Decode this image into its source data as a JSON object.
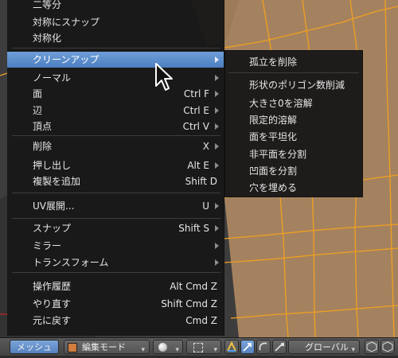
{
  "menu": {
    "items": [
      {
        "label": "二等分",
        "shortcut": "",
        "submenu": false
      },
      {
        "label": "対称にスナップ",
        "shortcut": "",
        "submenu": false
      },
      {
        "label": "対称化",
        "shortcut": "",
        "submenu": false
      },
      {
        "label": "クリーンアップ",
        "shortcut": "",
        "submenu": true,
        "highlighted": true
      },
      {
        "label": "ノーマル",
        "shortcut": "",
        "submenu": true
      },
      {
        "label": "面",
        "shortcut": "Ctrl F",
        "submenu": true
      },
      {
        "label": "辺",
        "shortcut": "Ctrl E",
        "submenu": true
      },
      {
        "label": "頂点",
        "shortcut": "Ctrl V",
        "submenu": true
      },
      {
        "label": "削除",
        "shortcut": "X",
        "submenu": true
      },
      {
        "label": "押し出し",
        "shortcut": "Alt E",
        "submenu": true
      },
      {
        "label": "複製を追加",
        "shortcut": "Shift D",
        "submenu": false
      },
      {
        "label": "UV展開...",
        "shortcut": "U",
        "submenu": true
      },
      {
        "label": "スナップ",
        "shortcut": "Shift S",
        "submenu": true
      },
      {
        "label": "ミラー",
        "shortcut": "",
        "submenu": true
      },
      {
        "label": "トランスフォーム",
        "shortcut": "",
        "submenu": true
      },
      {
        "label": "操作履歴",
        "shortcut": "Alt Cmd Z",
        "submenu": false
      },
      {
        "label": "やり直す",
        "shortcut": "Shift Cmd Z",
        "submenu": false
      },
      {
        "label": "元に戻す",
        "shortcut": "Cmd Z",
        "submenu": false
      }
    ]
  },
  "cleanup_submenu": {
    "items": [
      "孤立を削除",
      "形状のポリゴン数削減",
      "大きさ0を溶解",
      "限定的溶解",
      "面を平坦化",
      "非平面を分割",
      "凹面を分割",
      "穴を埋める"
    ]
  },
  "header": {
    "menu_label": "メッシュ",
    "mode_label": "編集モード",
    "orientation_label": "グローバル"
  },
  "colors": {
    "highlight": "#5a8fcf",
    "mesh_face": "#a5825f",
    "mesh_edge": "#f0a020",
    "menu_bg": "#181818"
  },
  "icons": {
    "submenu_arrow": "chevron-right-icon",
    "cursor": "mouse-pointer-icon",
    "shading": "sphere-icon",
    "pivot": "pivot-icon"
  }
}
